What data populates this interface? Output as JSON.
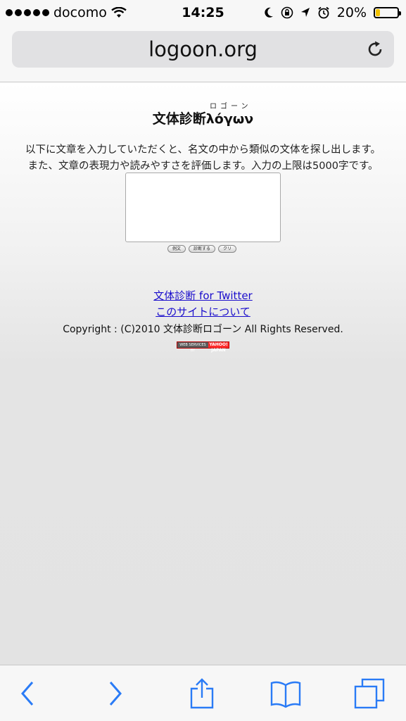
{
  "status_bar": {
    "carrier": "docomo",
    "time": "14:25",
    "battery": "20%",
    "battery_level": 0.2,
    "battery_color": "#f2c200"
  },
  "browser": {
    "url": "logoon.org",
    "reload_icon": "reload-icon"
  },
  "page": {
    "title_ruby": "ロゴーン",
    "title": "文体診断λόγων",
    "desc_line1": "以下に文章を入力していただくと、名文の中から類似の文体を探し出します。",
    "desc_line2": "また、文章の表現力や読みやすさを評価します。入力の上限は5000字です。",
    "textarea_value": "",
    "buttons": {
      "example": "例文",
      "diagnose": "診断する",
      "clear": "クリ"
    },
    "links": {
      "twitter": "文体診断 for Twitter",
      "about": "このサイトについて"
    },
    "copyright": "Copyright : (C)2010 文体診断ロゴーン All Rights Reserved.",
    "badge": {
      "left": "WEB SERVICES BY",
      "right": "YAHOO! JAPAN"
    },
    "link_color": "#1a0dcc"
  },
  "toolbar": {
    "icons": [
      "back-icon",
      "forward-icon",
      "share-icon",
      "bookmarks-icon",
      "tabs-icon"
    ],
    "accent": "#2a7bf6"
  }
}
